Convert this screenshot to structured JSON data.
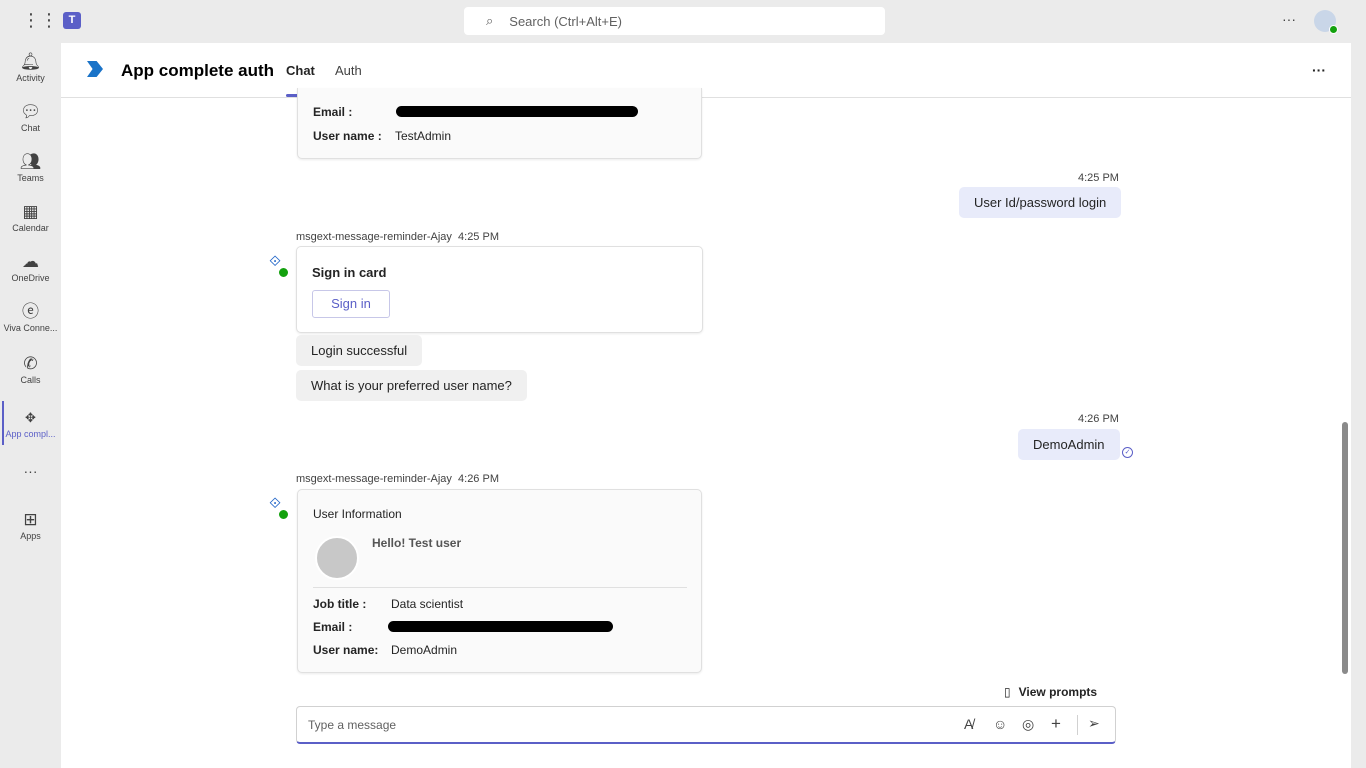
{
  "topbar": {
    "search_placeholder": "Search (Ctrl+Alt+E)"
  },
  "rail": [
    {
      "label": "Activity",
      "icon": "bell-icon"
    },
    {
      "label": "Chat",
      "icon": "chat-icon"
    },
    {
      "label": "Teams",
      "icon": "teams-icon"
    },
    {
      "label": "Calendar",
      "icon": "calendar-icon"
    },
    {
      "label": "OneDrive",
      "icon": "cloud-icon"
    },
    {
      "label": "Viva Conne...",
      "icon": "viva-icon"
    },
    {
      "label": "Calls",
      "icon": "phone-icon"
    },
    {
      "label": "App compl...",
      "icon": "app-icon"
    },
    {
      "label": "Apps",
      "icon": "plus-icon"
    }
  ],
  "header": {
    "title": "App complete auth",
    "tabs": [
      "Chat",
      "Auth"
    ],
    "accent": "#5b5fc7"
  },
  "messages": {
    "card1": {
      "email_label": "Email :",
      "username_label": "User name :",
      "username": "TestAdmin"
    },
    "me1": {
      "time": "4:25 PM",
      "text": "User Id/password login"
    },
    "bot1": {
      "sender": "msgext-message-reminder-Ajay",
      "time": "4:25 PM",
      "card_title": "Sign in card",
      "button": "Sign in",
      "msg2": "Login successful",
      "msg3": "What is your preferred user name?"
    },
    "me2": {
      "time": "4:26 PM",
      "text": "DemoAdmin"
    },
    "bot2": {
      "sender": "msgext-message-reminder-Ajay",
      "time": "4:26 PM",
      "card_title": "User Information",
      "greeting": "Hello! Test user",
      "job_label": "Job title :",
      "job": "Data scientist",
      "email_label": "Email :",
      "username_label": "User name:",
      "username": "DemoAdmin"
    }
  },
  "compose": {
    "view_prompts": "View prompts",
    "placeholder": "Type a message"
  }
}
